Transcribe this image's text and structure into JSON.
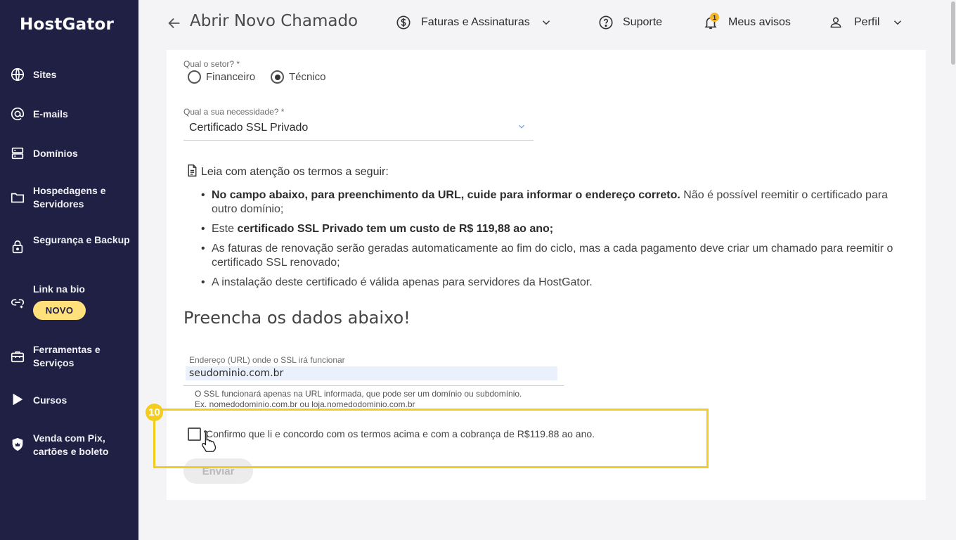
{
  "app": {
    "logo": "HostGator"
  },
  "sidebar": {
    "items": [
      {
        "label": "Sites",
        "icon": "globe-icon"
      },
      {
        "label": "E-mails",
        "icon": "at-sign-icon"
      },
      {
        "label": "Domínios",
        "icon": "server-icon"
      },
      {
        "label": "Hospedagens e Servidores",
        "icon": "folder-icon"
      },
      {
        "label": "Segurança e Backup",
        "icon": "lock-icon"
      },
      {
        "label": "Link na bio",
        "icon": "link-icon",
        "badge": "NOVO"
      },
      {
        "label": "Ferramentas e Serviços",
        "icon": "toolbox-icon"
      },
      {
        "label": "Cursos",
        "icon": "play-icon"
      },
      {
        "label": "Venda com Pix, cartões e boleto",
        "icon": "shield-icon"
      }
    ]
  },
  "header": {
    "title": "Abrir Novo Chamado",
    "billing": "Faturas e Assinaturas",
    "support": "Suporte",
    "notices": "Meus avisos",
    "notices_count": "1",
    "profile": "Perfil"
  },
  "form": {
    "sector_label": "Qual o setor? *",
    "sector_options": [
      "Financeiro",
      "Técnico"
    ],
    "sector_selected": "Técnico",
    "need_label": "Qual a sua necessidade? *",
    "need_value": "Certificado SSL Privado",
    "terms_heading": "Leia com atenção os termos a seguir:",
    "terms": [
      {
        "bold": "No campo abaixo, para preenchimento da URL, cuide para informar o endereço correto.",
        "text": " Não é possível reemitir o certificado para outro domínio;"
      },
      {
        "prefix": "Este ",
        "bold": "certificado SSL Privado tem um custo de R$ 119,88 ao ano;",
        "text": ""
      },
      {
        "text": "As faturas de renovação serão geradas automaticamente ao fim do ciclo, mas a cada pagamento deve criar um chamado para reemitir o certificado SSL renovado;"
      },
      {
        "text": "A instalação deste certificado é válida apenas para servidores da HostGator."
      }
    ],
    "section_title": "Preencha os dados abaixo!",
    "url_label": "Endereço (URL) onde o SSL irá funcionar",
    "url_value": "seudominio.com.br",
    "helper_line1": "O SSL funcionará apenas na URL informada, que pode ser um domínio ou subdomínio.",
    "helper_line2": "Ex. nomedodominio.com.br ou loja.nomedodominio.com.br",
    "confirm_text": "Confirmo que li e concordo com os termos acima e com a cobrança de R$119.88 ao ano.",
    "send_label": "Enviar"
  },
  "overlay": {
    "step": "10",
    "color": "#f2cd1f"
  },
  "colors": {
    "sidebar": "#1f2044",
    "badge": "#ffe07a",
    "highlight": "#f2cd1f"
  }
}
